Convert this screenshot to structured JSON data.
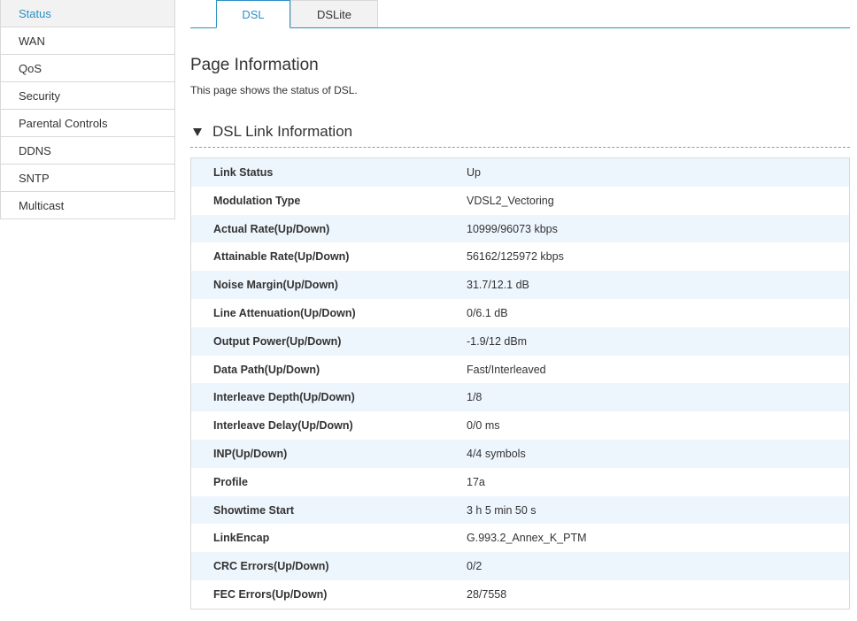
{
  "sidebar": {
    "items": [
      {
        "label": "Status"
      },
      {
        "label": "WAN"
      },
      {
        "label": "QoS"
      },
      {
        "label": "Security"
      },
      {
        "label": "Parental Controls"
      },
      {
        "label": "DDNS"
      },
      {
        "label": "SNTP"
      },
      {
        "label": "Multicast"
      }
    ],
    "active": "Status"
  },
  "tabs": [
    {
      "label": "DSL",
      "active": true
    },
    {
      "label": "DSLite",
      "active": false
    }
  ],
  "page": {
    "title": "Page Information",
    "description": "This page shows the status of DSL."
  },
  "section": {
    "title": "DSL Link Information",
    "expanded": true
  },
  "table": {
    "rows": [
      {
        "label": "Link Status",
        "value": "Up"
      },
      {
        "label": "Modulation Type",
        "value": "VDSL2_Vectoring"
      },
      {
        "label": "Actual Rate(Up/Down)",
        "value": "10999/96073 kbps"
      },
      {
        "label": "Attainable Rate(Up/Down)",
        "value": "56162/125972 kbps"
      },
      {
        "label": "Noise Margin(Up/Down)",
        "value": "31.7/12.1 dB"
      },
      {
        "label": "Line Attenuation(Up/Down)",
        "value": "0/6.1 dB"
      },
      {
        "label": "Output Power(Up/Down)",
        "value": "-1.9/12 dBm"
      },
      {
        "label": "Data Path(Up/Down)",
        "value": "Fast/Interleaved"
      },
      {
        "label": "Interleave Depth(Up/Down)",
        "value": "1/8"
      },
      {
        "label": "Interleave Delay(Up/Down)",
        "value": "0/0 ms"
      },
      {
        "label": "INP(Up/Down)",
        "value": "4/4 symbols"
      },
      {
        "label": "Profile",
        "value": "17a"
      },
      {
        "label": "Showtime Start",
        "value": "3 h 5 min 50 s"
      },
      {
        "label": "LinkEncap",
        "value": "G.993.2_Annex_K_PTM"
      },
      {
        "label": "CRC Errors(Up/Down)",
        "value": "0/2"
      },
      {
        "label": "FEC Errors(Up/Down)",
        "value": "28/7558"
      }
    ]
  },
  "colors": {
    "accent": "#2b8fc6",
    "row_alt": "#eef6fd",
    "border": "#d8d8d8"
  }
}
